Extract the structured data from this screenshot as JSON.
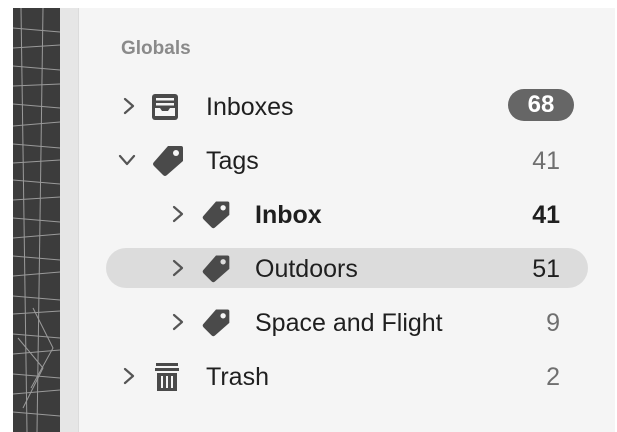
{
  "sidebar": {
    "section_title": "Globals",
    "items": [
      {
        "label": "Inboxes",
        "count": "68",
        "icon": "tray-icon",
        "expanded": false
      },
      {
        "label": "Tags",
        "count": "41",
        "icon": "tag-icon",
        "expanded": true
      },
      {
        "label": "Inbox",
        "count": "41",
        "icon": "tag-icon",
        "expanded": false
      },
      {
        "label": "Outdoors",
        "count": "51",
        "icon": "tag-icon",
        "expanded": false,
        "selected": true
      },
      {
        "label": "Space and Flight",
        "count": "9",
        "icon": "tag-icon",
        "expanded": false
      },
      {
        "label": "Trash",
        "count": "2",
        "icon": "trash-icon",
        "expanded": false
      }
    ]
  },
  "colors": {
    "sidebar_bg": "#f5f5f5",
    "selection_bg": "#dcdcdc",
    "badge_bg": "#666666",
    "icon": "#4a4a4a"
  }
}
